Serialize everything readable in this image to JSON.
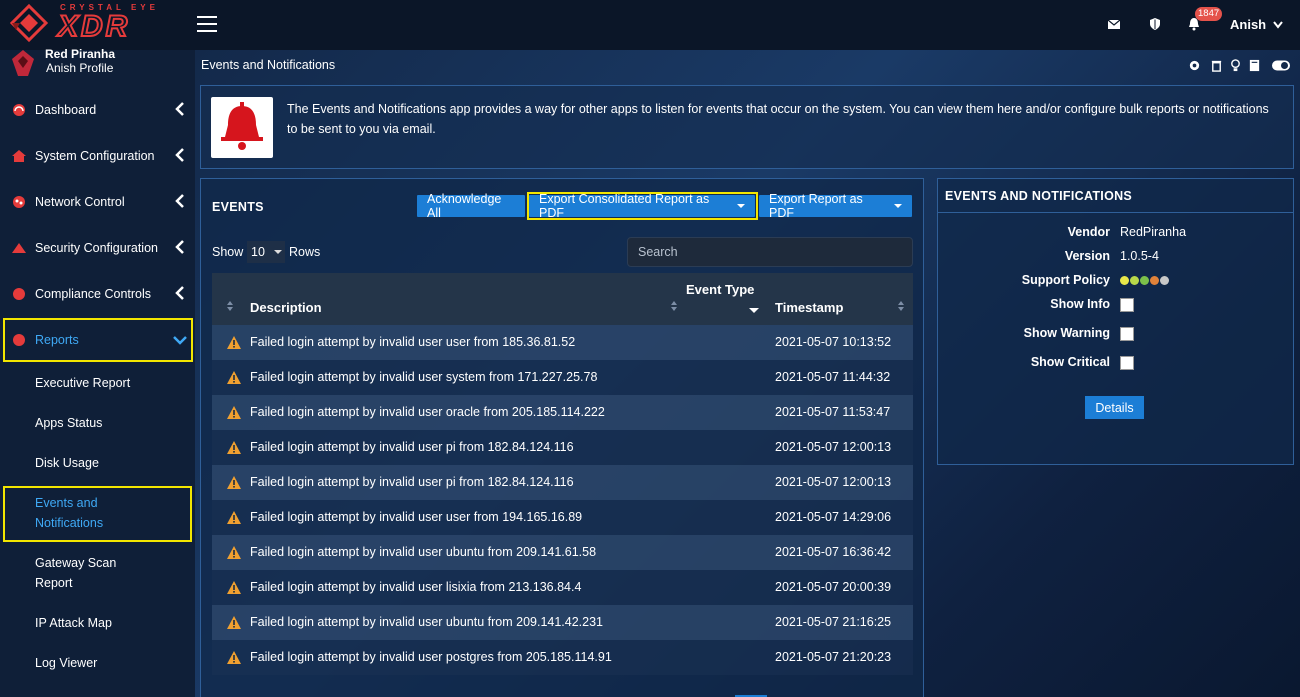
{
  "brand": {
    "sub": "CRYSTAL EYE",
    "main": "XDR",
    "accent": "#e53b3b"
  },
  "profile": {
    "name": "Red Piranha",
    "subtitle": "Anish Profile"
  },
  "nav": {
    "items": [
      {
        "label": "Dashboard"
      },
      {
        "label": "System Configuration"
      },
      {
        "label": "Network Control"
      },
      {
        "label": "Security Configuration"
      },
      {
        "label": "Compliance Controls"
      },
      {
        "label": "Reports"
      }
    ],
    "sub_items": [
      {
        "label": "Executive Report"
      },
      {
        "label": "Apps Status"
      },
      {
        "label": "Disk Usage"
      },
      {
        "label": "Events and",
        "label2": "Notifications"
      },
      {
        "label": "Gateway Scan",
        "label2": "Report"
      },
      {
        "label": "IP Attack Map"
      },
      {
        "label": "Log Viewer"
      }
    ]
  },
  "topbar": {
    "notification_count": "1847",
    "user": "Anish",
    "icons": [
      "mail-icon",
      "shield-icon",
      "bell-icon"
    ]
  },
  "page": {
    "title": "Events and Notifications",
    "description": "The Events and Notifications app provides a way for other apps to listen for events that occur on the system. You can view them here and/or configure bulk reports or notifications to be sent to you via email."
  },
  "events": {
    "title": "EVENTS",
    "acknowledge_label": "Acknowledge All",
    "export_consolidated_label": "Export Consolidated Report as PDF",
    "export_report_label": "Export Report as PDF",
    "show_label": "Show",
    "rows_label": "Rows",
    "page_size": "10",
    "search_placeholder": "Search",
    "columns": {
      "description": "Description",
      "event_type": "Event Type",
      "timestamp": "Timestamp"
    },
    "rows": [
      {
        "description": "Failed login attempt by invalid user user from 185.36.81.52",
        "timestamp": "2021-05-07 10:13:52"
      },
      {
        "description": "Failed login attempt by invalid user system from 171.227.25.78",
        "timestamp": "2021-05-07 11:44:32"
      },
      {
        "description": "Failed login attempt by invalid user oracle from 205.185.114.222",
        "timestamp": "2021-05-07 11:53:47"
      },
      {
        "description": "Failed login attempt by invalid user pi from 182.84.124.116",
        "timestamp": "2021-05-07 12:00:13"
      },
      {
        "description": "Failed login attempt by invalid user pi from 182.84.124.116",
        "timestamp": "2021-05-07 12:00:13"
      },
      {
        "description": "Failed login attempt by invalid user user from 194.165.16.89",
        "timestamp": "2021-05-07 14:29:06"
      },
      {
        "description": "Failed login attempt by invalid user ubuntu from 209.141.61.58",
        "timestamp": "2021-05-07 16:36:42"
      },
      {
        "description": "Failed login attempt by invalid user lisixia from 213.136.84.4",
        "timestamp": "2021-05-07 20:00:39"
      },
      {
        "description": "Failed login attempt by invalid user ubuntu from 209.141.42.231",
        "timestamp": "2021-05-07 21:16:25"
      },
      {
        "description": "Failed login attempt by invalid user postgres from 205.185.114.91",
        "timestamp": "2021-05-07 21:20:23"
      }
    ]
  },
  "app_info": {
    "title": "EVENTS AND NOTIFICATIONS",
    "vendor_label": "Vendor",
    "vendor": "RedPiranha",
    "version_label": "Version",
    "version": "1.0.5-4",
    "support_label": "Support Policy",
    "support_colors": [
      "#e8e84a",
      "#b8d84a",
      "#7cc04a",
      "#e0823a",
      "#c8c8c8"
    ],
    "show_info_label": "Show Info",
    "show_warning_label": "Show Warning",
    "show_critical_label": "Show Critical",
    "details_label": "Details"
  },
  "colors": {
    "highlight": "#f2e600",
    "button": "#1c7ed6",
    "warning": "#f0a030"
  }
}
